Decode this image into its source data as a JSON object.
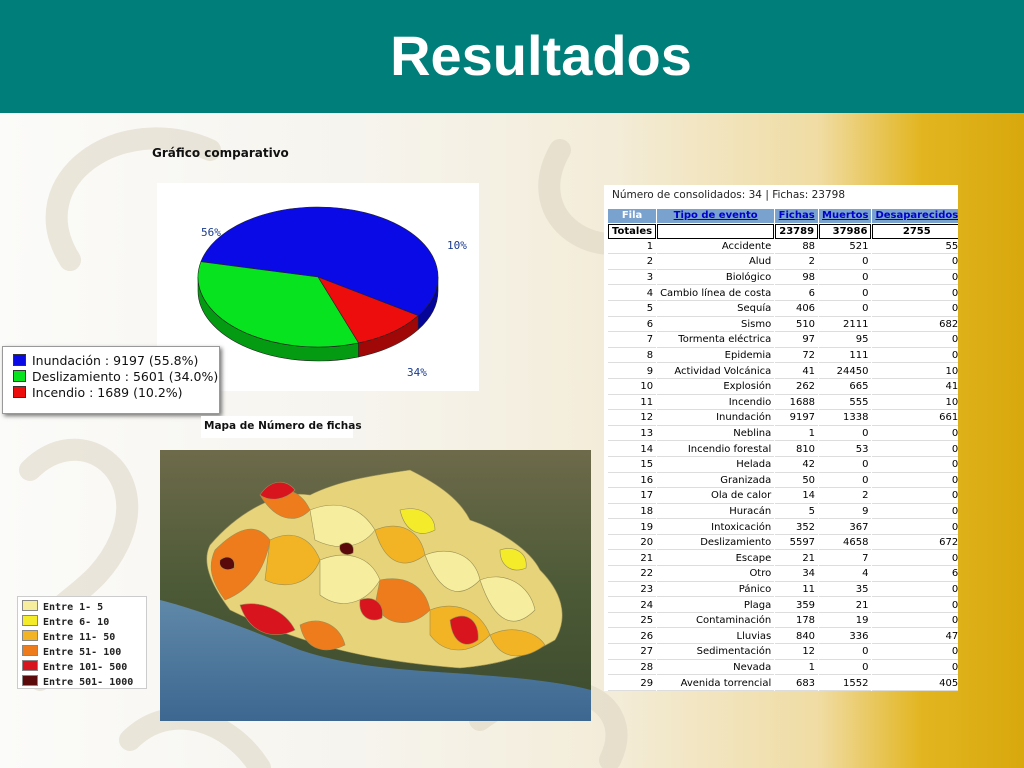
{
  "header": {
    "title": "Resultados"
  },
  "pie": {
    "caption": "Gráfico comparativo",
    "pct_labels": [
      "56%",
      "10%",
      "34%"
    ],
    "colors": {
      "inundacion": "#0a0ae6",
      "deslizamiento": "#07e31e",
      "incendio": "#ee0d0d"
    },
    "legend": [
      "Inundación : 9197 (55.8%)",
      "Deslizamiento : 5601 (34.0%)",
      "Incendio : 1689 (10.2%)"
    ]
  },
  "chart_data": {
    "type": "pie",
    "categories": [
      "Inundación",
      "Deslizamiento",
      "Incendio"
    ],
    "values": [
      9197,
      5601,
      1689
    ],
    "percentages": [
      55.8,
      34.0,
      10.2
    ],
    "title": "Gráfico comparativo"
  },
  "map": {
    "caption": "Mapa de Número de fichas",
    "legend": [
      {
        "label": "Entre 1- 5",
        "color": "#f6ee9e"
      },
      {
        "label": "Entre 6- 10",
        "color": "#f4ec2a"
      },
      {
        "label": "Entre 11- 50",
        "color": "#f2b324"
      },
      {
        "label": "Entre 51- 100",
        "color": "#ee7b1c"
      },
      {
        "label": "Entre 101- 500",
        "color": "#d8141e"
      },
      {
        "label": "Entre 501- 1000",
        "color": "#5a0a0a"
      }
    ]
  },
  "table": {
    "caption": "Número de consolidados: 34 | Fichas: 23798",
    "headers": {
      "fila": "Fila",
      "tipo": "Tipo de evento",
      "fichas": "Fichas",
      "muertos": "Muertos",
      "desaparecidos": "Desaparecidos"
    },
    "totals": {
      "label": "Totales",
      "fichas": "23789",
      "muertos": "37986",
      "desaparecidos": "2755"
    },
    "rows": [
      [
        "1",
        "Accidente",
        "88",
        "521",
        "55"
      ],
      [
        "2",
        "Alud",
        "2",
        "0",
        "0"
      ],
      [
        "3",
        "Biológico",
        "98",
        "0",
        "0"
      ],
      [
        "4",
        "Cambio línea de costa",
        "6",
        "0",
        "0"
      ],
      [
        "5",
        "Sequía",
        "406",
        "0",
        "0"
      ],
      [
        "6",
        "Sismo",
        "510",
        "2111",
        "682"
      ],
      [
        "7",
        "Tormenta eléctrica",
        "97",
        "95",
        "0"
      ],
      [
        "8",
        "Epidemia",
        "72",
        "111",
        "0"
      ],
      [
        "9",
        "Actividad Volcánica",
        "41",
        "24450",
        "10"
      ],
      [
        "10",
        "Explosión",
        "262",
        "665",
        "41"
      ],
      [
        "11",
        "Incendio",
        "1688",
        "555",
        "10"
      ],
      [
        "12",
        "Inundación",
        "9197",
        "1338",
        "661"
      ],
      [
        "13",
        "Neblina",
        "1",
        "0",
        "0"
      ],
      [
        "14",
        "Incendio forestal",
        "810",
        "53",
        "0"
      ],
      [
        "15",
        "Helada",
        "42",
        "0",
        "0"
      ],
      [
        "16",
        "Granizada",
        "50",
        "0",
        "0"
      ],
      [
        "17",
        "Ola de calor",
        "14",
        "2",
        "0"
      ],
      [
        "18",
        "Huracán",
        "5",
        "9",
        "0"
      ],
      [
        "19",
        "Intoxicación",
        "352",
        "367",
        "0"
      ],
      [
        "20",
        "Deslizamiento",
        "5597",
        "4658",
        "672"
      ],
      [
        "21",
        "Escape",
        "21",
        "7",
        "0"
      ],
      [
        "22",
        "Otro",
        "34",
        "4",
        "6"
      ],
      [
        "23",
        "Pánico",
        "11",
        "35",
        "0"
      ],
      [
        "24",
        "Plaga",
        "359",
        "21",
        "0"
      ],
      [
        "25",
        "Contaminación",
        "178",
        "19",
        "0"
      ],
      [
        "26",
        "Lluvias",
        "840",
        "336",
        "47"
      ],
      [
        "27",
        "Sedimentación",
        "12",
        "0",
        "0"
      ],
      [
        "28",
        "Nevada",
        "1",
        "0",
        "0"
      ],
      [
        "29",
        "Avenida torrencial",
        "683",
        "1552",
        "405"
      ]
    ]
  }
}
